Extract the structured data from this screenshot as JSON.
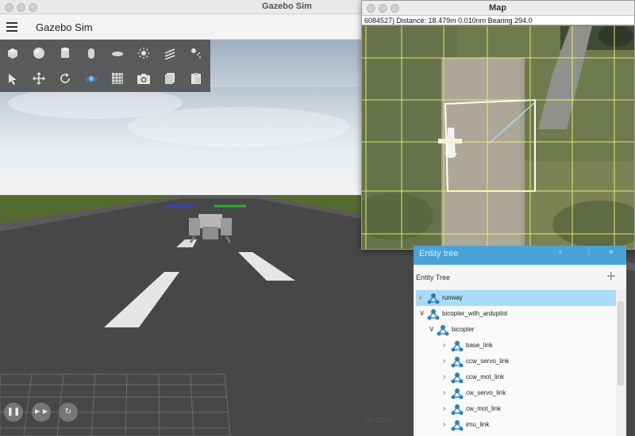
{
  "gazebo_window": {
    "title": "Gazebo Sim",
    "app_title": "Gazebo Sim"
  },
  "toolbar": {
    "row1": [
      "box-icon",
      "sphere-icon",
      "cylinder-icon",
      "capsule-icon",
      "ellipsoid-icon",
      "sun-light-icon",
      "directional-light-icon",
      "spot-light-icon"
    ],
    "row2": [
      "select-arrow-icon",
      "translate-icon",
      "rotate-icon",
      "view-angle-icon",
      "grid-icon",
      "camera-icon",
      "copy-icon",
      "paste-icon"
    ]
  },
  "playback": {
    "real_time_factor": "98.52 %",
    "arrow": "‹"
  },
  "map_window": {
    "title": "Map",
    "status": "6084527) Distance: 18.479m 0.010nm Bearing 294.0"
  },
  "entity_tree": {
    "panel_title": "Entity tree",
    "header_buttons": [
      "▫",
      "⋮",
      "×"
    ],
    "subtitle": "Entity Tree",
    "add_label": "+",
    "rows": [
      {
        "label": "runway",
        "depth": 0,
        "expanded": false,
        "selected": true
      },
      {
        "label": "bicopter_with_ardupilot",
        "depth": 0,
        "expanded": true,
        "selected": false
      },
      {
        "label": "bicopter",
        "depth": 1,
        "expanded": true,
        "selected": false
      },
      {
        "label": "base_link",
        "depth": 2,
        "expanded": false,
        "selected": false
      },
      {
        "label": "ccw_servo_link",
        "depth": 2,
        "expanded": false,
        "selected": false
      },
      {
        "label": "ccw_mot_link",
        "depth": 2,
        "expanded": false,
        "selected": false
      },
      {
        "label": "cw_servo_link",
        "depth": 2,
        "expanded": false,
        "selected": false
      },
      {
        "label": "cw_mot_link",
        "depth": 2,
        "expanded": false,
        "selected": false
      },
      {
        "label": "imu_link",
        "depth": 2,
        "expanded": false,
        "selected": false
      },
      {
        "label": "",
        "depth": 2,
        "expanded": false,
        "selected": false
      }
    ]
  },
  "colors": {
    "accent": "#4aa3d8",
    "selected_row": "#a9dcf4",
    "map_grid": "#f3f36a",
    "grass": "#566b2f"
  }
}
